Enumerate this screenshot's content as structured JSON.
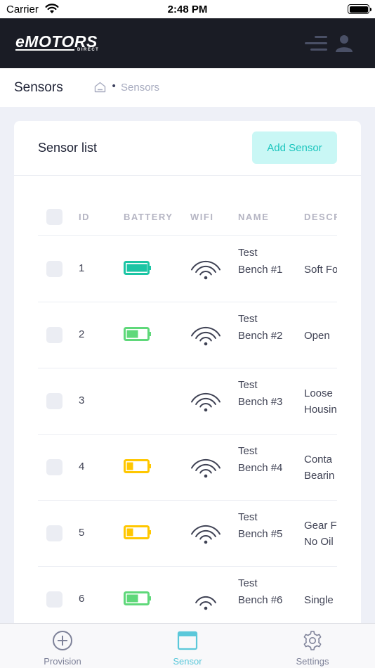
{
  "status_bar": {
    "carrier": "Carrier",
    "time": "2:48 PM"
  },
  "app": {
    "logo_main": "eMOTORS",
    "logo_sub": "DIRECT"
  },
  "subheader": {
    "title": "Sensors",
    "breadcrumb": "Sensors"
  },
  "card": {
    "title": "Sensor list",
    "add_button": "Add Sensor"
  },
  "table": {
    "headers": {
      "id": "ID",
      "battery": "BATTERY",
      "wifi": "WIFI",
      "name": "NAME",
      "description": "DESCR"
    },
    "rows": [
      {
        "id": "1",
        "battery": "full",
        "wifi_level": 4,
        "name": "Test Bench #1",
        "description": "Soft Fo"
      },
      {
        "id": "2",
        "battery": "half",
        "wifi_level": 4,
        "name": "Test Bench #2",
        "description": "Open"
      },
      {
        "id": "3",
        "battery": "none",
        "wifi_level": 4,
        "name": "Test Bench #3",
        "description": "Loose\nHousin"
      },
      {
        "id": "4",
        "battery": "low",
        "wifi_level": 4,
        "name": "Test Bench #4",
        "description": "Conta\nBearin"
      },
      {
        "id": "5",
        "battery": "low",
        "wifi_level": 4,
        "name": "Test Bench #5",
        "description": "Gear F\nNo Oil"
      },
      {
        "id": "6",
        "battery": "half",
        "wifi_level": 2,
        "name": "Test Bench #6",
        "description": "Single"
      }
    ]
  },
  "battery_colors": {
    "full": "#1bc5a4",
    "half": "#5fd87a",
    "low": "#ffc700"
  },
  "tabbar": {
    "tabs": [
      {
        "label": "Provision",
        "icon": "plus-circle-icon"
      },
      {
        "label": "Sensor",
        "icon": "window-icon",
        "active": true
      },
      {
        "label": "Settings",
        "icon": "gear-icon"
      }
    ]
  }
}
